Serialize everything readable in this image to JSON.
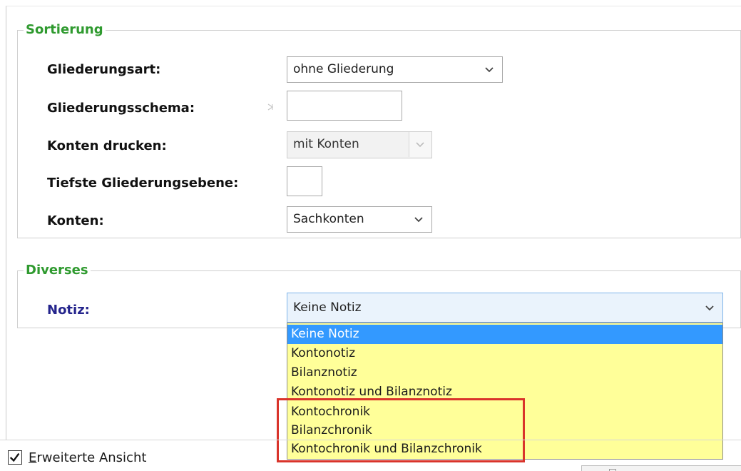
{
  "sortierung": {
    "title": "Sortierung",
    "gliederungsart": {
      "label": "Gliederungsart:",
      "value": "ohne Gliederung",
      "icon": "chevron-down-icon"
    },
    "gliederungsschema": {
      "label": "Gliederungsschema:",
      "value": ""
    },
    "konten_drucken": {
      "label": "Konten drucken:",
      "value": "mit Konten",
      "icon": "chevron-down-icon"
    },
    "tiefste_gliederungsebene": {
      "label": "Tiefste Gliederungsebene:",
      "value": ""
    },
    "konten": {
      "label": "Konten:",
      "value": "Sachkonten",
      "icon": "chevron-down-icon"
    }
  },
  "diverses": {
    "title": "Diverses",
    "notiz": {
      "label": "Notiz:",
      "value": "Keine Notiz",
      "icon": "chevron-down-icon",
      "options": [
        "Keine Notiz",
        "Kontonotiz",
        "Bilanznotiz",
        "Kontonotiz und Bilanznotiz",
        "Kontochronik",
        "Bilanzchronik",
        "Kontochronik und Bilanzchronik"
      ],
      "selected_option": "Keine Notiz"
    }
  },
  "footer": {
    "erweiterte_ansicht_prefix": "E",
    "erweiterte_ansicht_rest": "rweiterte Ansicht",
    "erweiterte_ansicht_checked": true
  },
  "colors": {
    "group_title": "#2f9a2f",
    "notiz_label": "#24248c",
    "dropdown_background": "#ffff99",
    "selected_item": "#3399ff",
    "highlight_border": "#d9342b"
  }
}
